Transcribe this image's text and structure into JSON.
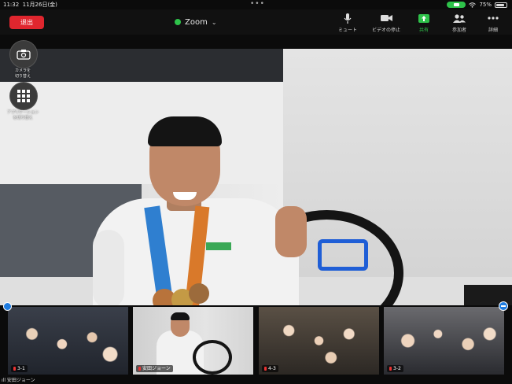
{
  "status_bar": {
    "time": "11:32",
    "date": "11月26日(金)",
    "more_dots": "•••",
    "battery": "75%"
  },
  "toolbar": {
    "leave_label": "退出",
    "app_title": "Zoom",
    "chevron": "⌄",
    "items": [
      {
        "label": "ミュート",
        "icon": "microphone-icon",
        "color": "#cfcfcf"
      },
      {
        "label": "ビデオの停止",
        "icon": "video-camera-icon",
        "color": "#cfcfcf"
      },
      {
        "label": "共有",
        "icon": "share-screen-icon",
        "color": "#2ec24a"
      },
      {
        "label": "参加者",
        "icon": "participants-icon",
        "color": "#cfcfcf"
      },
      {
        "label": "詳細",
        "icon": "more-icon",
        "color": "#cfcfcf"
      }
    ]
  },
  "side_controls": {
    "camera_switch": "カメラを\n切り替え",
    "apps": "アプリケーション\nを切り替え"
  },
  "thumbnails": [
    {
      "name": "3-1",
      "muted": true
    },
    {
      "name": "安田ジョーン",
      "muted": true
    },
    {
      "name": "4-3",
      "muted": true
    },
    {
      "name": "3-2",
      "muted": true
    }
  ],
  "footer_label": "ıll 安田ジョーン",
  "colors": {
    "leave": "#e0262e",
    "active_speaker": "#2fcf52",
    "accent_blue": "#1f7ce0"
  }
}
